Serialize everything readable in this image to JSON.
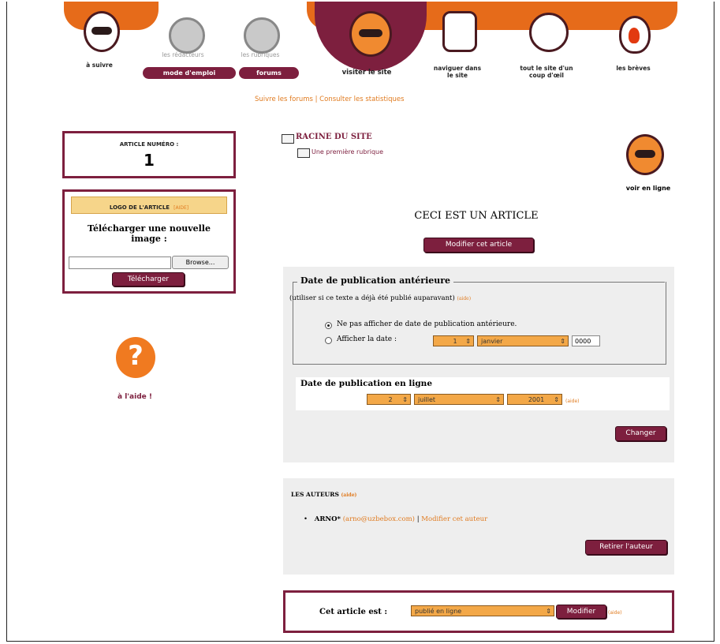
{
  "nav": {
    "a_suivre": "à suivre",
    "redacteurs": "les rédacteurs",
    "rubriques": "les rubriques",
    "mode_emploi": "mode d'emploi",
    "forums": "forums",
    "visiter": "visiter le site",
    "naviguer": "naviguer dans le site",
    "tout_le_site": "tout le site d'un coup d'œil",
    "breves": "les brèves",
    "subnav": "Suivre les forums | Consulter les statistiques"
  },
  "article_box": {
    "title": "ARTICLE NUMÉRO :",
    "number": "1"
  },
  "logo_box": {
    "title": "LOGO DE L'ARTICLE",
    "aide": "[AIDE]",
    "upload_label": "Télécharger une nouvelle image :",
    "browse": "Browse...",
    "upload_button": "Télécharger"
  },
  "help": {
    "label": "à l'aide !"
  },
  "breadcrumb": {
    "root": "RACINE DU SITE",
    "rubrique": "Une première rubrique"
  },
  "voir_en_ligne": "voir en ligne",
  "article": {
    "title": "CECI EST UN ARTICLE",
    "modify_button": "Modifier cet article"
  },
  "pub_anterieure": {
    "legend": "Date de publication antérieure",
    "note": "(utiliser si ce texte a déjà été publié auparavant)",
    "aide": "(aide)",
    "option_none": "Ne pas afficher de date de publication antérieure.",
    "option_date": "Afficher la date :",
    "day": "1",
    "month": "janvier",
    "year": "0000"
  },
  "pub_en_ligne": {
    "label": "Date de publication en ligne",
    "day": "2",
    "month": "juillet",
    "year": "2001",
    "aide": "(aide)",
    "change_button": "Changer"
  },
  "authors": {
    "title": "LES AUTEURS",
    "aide": "(aide)",
    "name": "ARNO*",
    "email": "(arno@uzbebox.com)",
    "modify": "Modifier cet auteur",
    "remove_button": "Retirer l'auteur"
  },
  "status": {
    "label": "Cet article est :",
    "value": "publié en ligne",
    "button": "Modifier",
    "aide": "(aide)"
  },
  "colors": {
    "maroon": "#7d1f3e",
    "orange": "#e66b1a",
    "select_orange": "#f3a848"
  }
}
